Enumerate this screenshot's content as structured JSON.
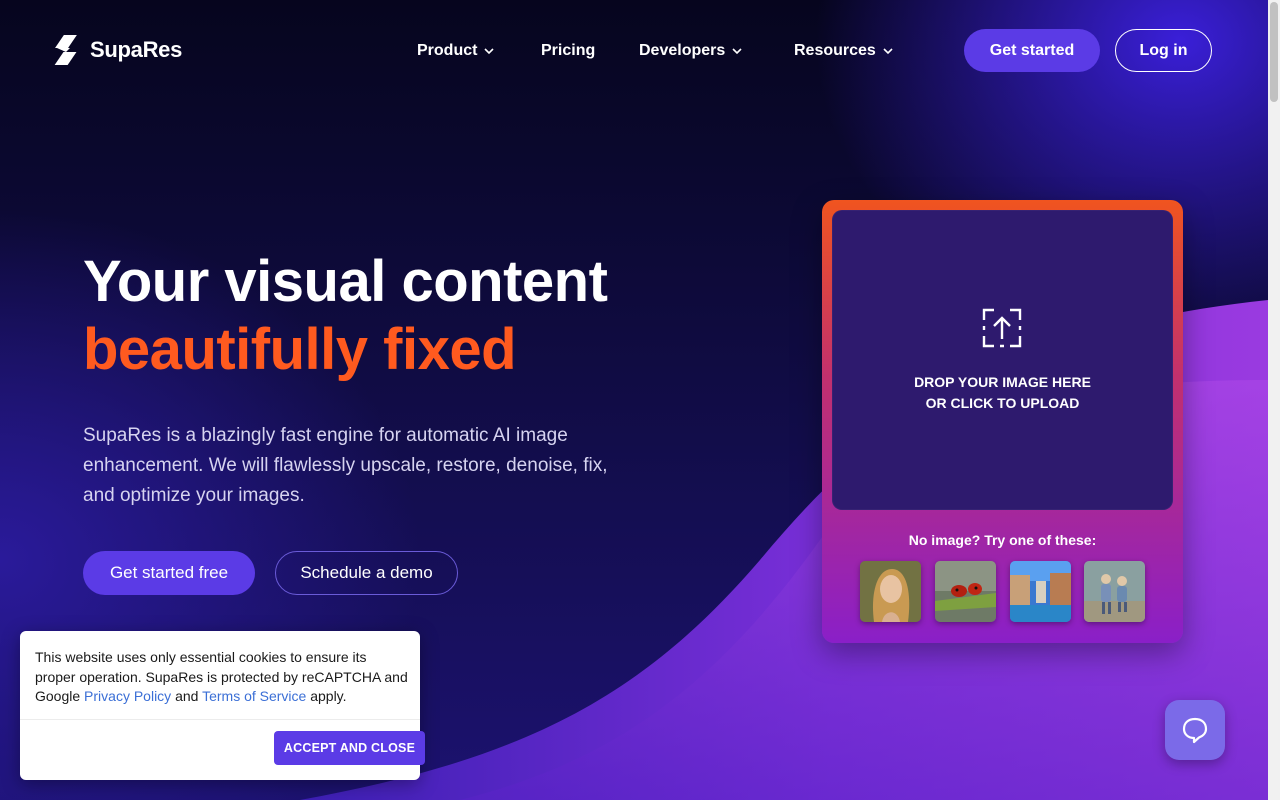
{
  "brand": {
    "name": "SupaRes",
    "logo_icon": "suparess-logo-icon"
  },
  "nav": {
    "items": [
      {
        "label": "Product",
        "has_dropdown": true
      },
      {
        "label": "Pricing",
        "has_dropdown": false
      },
      {
        "label": "Developers",
        "has_dropdown": true
      },
      {
        "label": "Resources",
        "has_dropdown": true
      }
    ],
    "get_started_label": "Get started",
    "login_label": "Log in"
  },
  "hero": {
    "title_line1": "Your visual content",
    "title_line2": "beautifully fixed",
    "subtitle": "SupaRes is a blazingly fast engine for automatic AI image enhancement. We will flawlessly upscale, restore, denoise, fix, and optimize your images.",
    "primary_cta": "Get started free",
    "secondary_cta": "Schedule a demo"
  },
  "upload": {
    "line1": "DROP YOUR IMAGE HERE",
    "line2": "OR CLICK TO UPLOAD",
    "sample_label": "No image? Try one of these:",
    "samples": [
      "portrait-woman",
      "ladybug-on-leaf",
      "canal-town",
      "children-walking"
    ]
  },
  "cookie": {
    "text_before": "This website uses only essential cookies to ensure its proper operation. SupaRes is protected by reCAPTCHA and Google ",
    "privacy_link": "Privacy Policy",
    "text_and": " and ",
    "terms_link": "Terms of Service",
    "text_after": " apply.",
    "accept_label": "ACCEPT AND CLOSE"
  },
  "colors": {
    "accent_purple": "#5b3be6",
    "accent_orange": "#ff5a1f",
    "background": "#0c0a2e"
  }
}
